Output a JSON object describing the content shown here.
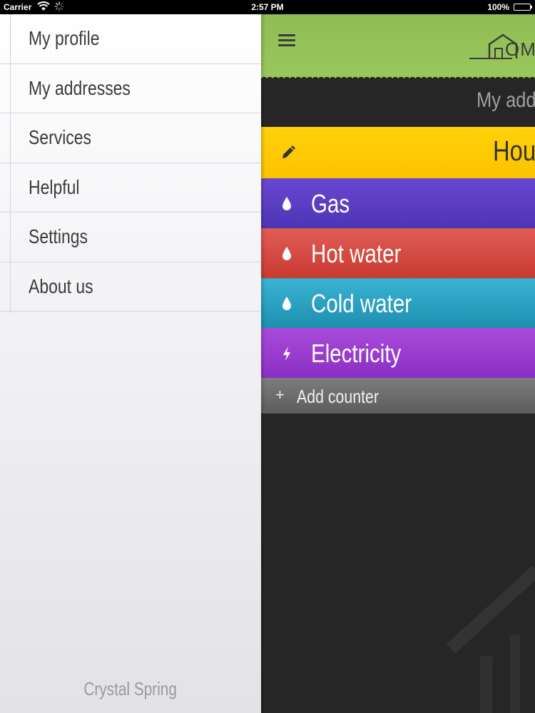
{
  "status_bar": {
    "carrier": "Carrier",
    "time": "2:57 PM",
    "battery": "100%",
    "battery_level": 1.0
  },
  "sidebar": {
    "items": [
      {
        "label": "My profile"
      },
      {
        "label": "My addresses"
      },
      {
        "label": "Services"
      },
      {
        "label": "Helpful"
      },
      {
        "label": "Settings"
      },
      {
        "label": "About us"
      }
    ],
    "footer": "Crystal Spring"
  },
  "header": {
    "logo_text": "OMC"
  },
  "main": {
    "section_title": "My addr",
    "address_label": "Hou",
    "counters": [
      {
        "label": "Gas",
        "icon": "drop-icon",
        "color": "#5b3fc4"
      },
      {
        "label": "Hot water",
        "icon": "drop-icon",
        "color": "#d24a43"
      },
      {
        "label": "Cold water",
        "icon": "drop-icon",
        "color": "#2ba1c3"
      },
      {
        "label": "Electricity",
        "icon": "lightning-icon",
        "color": "#9a3bcf"
      }
    ],
    "add_counter": {
      "plus": "+",
      "label": "Add counter"
    }
  },
  "colors": {
    "header_green": "#97c45b",
    "address_yellow": "#fcc800",
    "background_dark": "#262626"
  }
}
